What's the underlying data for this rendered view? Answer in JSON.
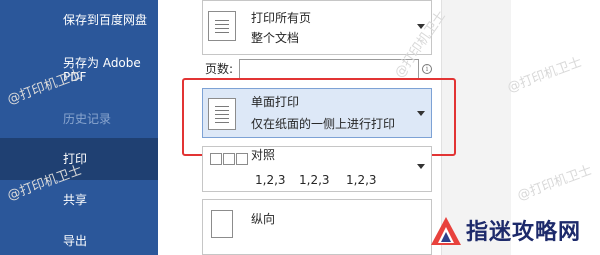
{
  "sidebar": {
    "items": [
      {
        "label": "保存到百度网盘"
      },
      {
        "label": "另存为 Adobe"
      },
      {
        "label": "PDF"
      },
      {
        "label": "历史记录"
      },
      {
        "label": "打印"
      },
      {
        "label": "共享"
      },
      {
        "label": "导出"
      }
    ]
  },
  "print_what": {
    "title": "打印所有页",
    "subtitle": "整个文档"
  },
  "pages": {
    "label": "页数:",
    "value": "",
    "info_icon": "i"
  },
  "sides": {
    "title": "单面打印",
    "subtitle": "仅在纸面的一侧上进行打印"
  },
  "collation": {
    "title": "对照",
    "values": [
      "1,2,3",
      "1,2,3",
      "1,2,3"
    ]
  },
  "orientation": {
    "title": "纵向"
  },
  "watermarks": [
    "@打印机卫士",
    "@打印机卫士",
    "@打印机卫士",
    "@打印机卫士",
    "@打印机卫士"
  ],
  "logo": {
    "text": "指迷攻略网"
  },
  "colors": {
    "sidebar": "#2b579a",
    "sidebar_active": "#1f4072",
    "highlight": "#e23434",
    "selected": "#dde8f7"
  }
}
